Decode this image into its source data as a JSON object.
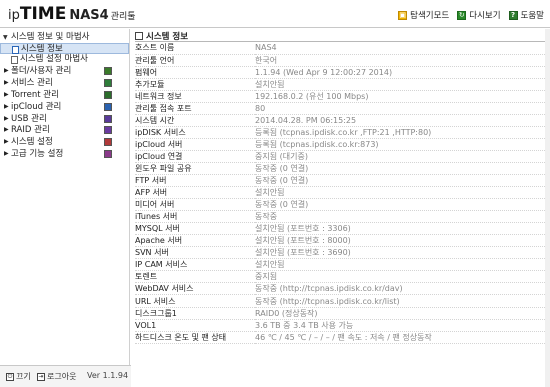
{
  "header": {
    "logo_ip": "ip",
    "logo_time": "TIME",
    "logo_model": "NAS4",
    "logo_sub": "관리툴",
    "links": [
      {
        "label": "탐색기모드",
        "icon": "explorer-icon"
      },
      {
        "label": "다시보기",
        "icon": "refresh-icon"
      },
      {
        "label": "도움말",
        "icon": "help-icon"
      }
    ]
  },
  "sidebar": {
    "root_label": "시스템 정보 및 마법사",
    "sub_items": [
      {
        "label": "시스템 정보"
      },
      {
        "label": "시스템 설정 마법사"
      }
    ],
    "groups": [
      {
        "label": "폴더/사용자 관리",
        "color": "#3a7a2a"
      },
      {
        "label": "서비스 관리",
        "color": "#2e7d3a"
      },
      {
        "label": "Torrent 관리",
        "color": "#2c6e2c"
      },
      {
        "label": "ipCloud 관리",
        "color": "#2a62b0"
      },
      {
        "label": "USB 관리",
        "color": "#5a3a9a"
      },
      {
        "label": "RAID 관리",
        "color": "#6a3aa0"
      },
      {
        "label": "시스템 설정",
        "color": "#b03a3a"
      },
      {
        "label": "고급 기능 설정",
        "color": "#8a3a8a"
      }
    ],
    "footer": {
      "power_label": "끄기",
      "logout_label": "로그아웃",
      "version": "Ver 1.1.94"
    }
  },
  "main": {
    "title": "시스템 정보",
    "rows": [
      {
        "key": "호스트 이름",
        "value": "NAS4"
      },
      {
        "key": "관리툴 언어",
        "value": "한국어"
      },
      {
        "key": "펌웨어",
        "value": "1.1.94 (Wed Apr 9 12:00:27 2014)"
      },
      {
        "key": "추가모듈",
        "value": "설치안됨"
      },
      {
        "key": "네트워크 정보",
        "value": "192.168.0.2 (유선 100 Mbps)"
      },
      {
        "key": "관리툴 접속 포트",
        "value": "80"
      },
      {
        "key": "시스템 시간",
        "value": "2014.04.28. PM 06:15:25"
      },
      {
        "key": "ipDISK 서비스",
        "value": "등록됨 (tcpnas.ipdisk.co.kr ,FTP:21 ,HTTP:80)"
      },
      {
        "key": "ipCloud 서버",
        "value": "등록됨 (tcpnas.ipdisk.co.kr:873)"
      },
      {
        "key": "ipCloud 연결",
        "value": "중지됨 (대기중)"
      },
      {
        "key": "윈도우 파일 공유",
        "value": "동작중 (0 연결)"
      },
      {
        "key": "FTP 서버",
        "value": "동작중 (0 연결)"
      },
      {
        "key": "AFP 서버",
        "value": "설치안됨"
      },
      {
        "key": "미디어 서버",
        "value": "동작중 (0 연결)"
      },
      {
        "key": "iTunes 서버",
        "value": "동작중"
      },
      {
        "key": "MYSQL 서버",
        "value": "설치안됨 (포트번호 : 3306)"
      },
      {
        "key": "Apache 서버",
        "value": "설치안됨 (포트번호 : 8000)"
      },
      {
        "key": "SVN 서버",
        "value": "설치안됨 (포트번호 : 3690)"
      },
      {
        "key": "IP CAM 서비스",
        "value": "설치안됨"
      },
      {
        "key": "토렌트",
        "value": "중지됨"
      },
      {
        "key": "WebDAV 서비스",
        "value": "동작중 (http://tcpnas.ipdisk.co.kr/dav)"
      },
      {
        "key": "URL 서비스",
        "value": "동작중 (http://tcpnas.ipdisk.co.kr/list)"
      },
      {
        "key": "디스크그룹1",
        "value": "RAID0 (정상동작)"
      },
      {
        "key": "VOL1",
        "value": "3.6 TB 중 3.4 TB 사용 가능",
        "indent": true
      },
      {
        "key": "하드디스크 온도 및 팬 상태",
        "value": "46 ℃ / 45 ℃ / – / – / 팬 속도 : 저속 / 팬 정상동작"
      }
    ]
  }
}
